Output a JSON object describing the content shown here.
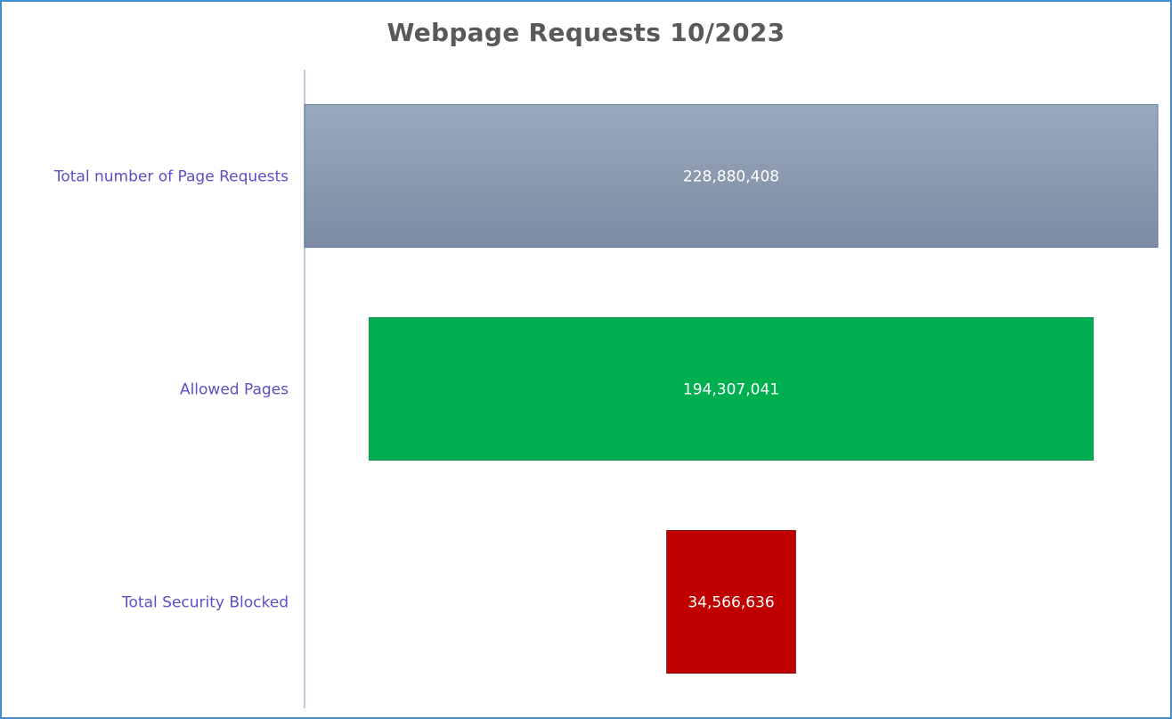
{
  "chart_data": {
    "type": "bar",
    "orientation": "horizontal",
    "style": "funnel",
    "title": "Webpage Requests 10/2023",
    "categories": [
      "Total number of Page Requests",
      "Allowed Pages",
      "Total Security Blocked"
    ],
    "values": [
      228880408,
      194307041,
      34566636
    ],
    "value_labels": [
      "228,880,408",
      "194,307,041",
      "34,566,636"
    ],
    "colors": [
      "#8a9ab0",
      "#00b050",
      "#c00000"
    ],
    "xlabel": "",
    "ylabel": "",
    "grid": false,
    "legend": "none"
  }
}
